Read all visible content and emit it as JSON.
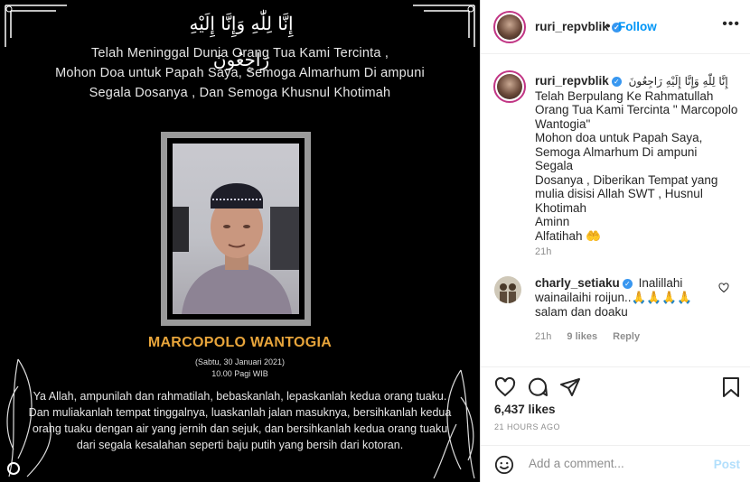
{
  "media": {
    "arabic_banner": "إِنَّا لِلّٰهِ وَإِنَّا إِلَيْهِ رَاجِعُونَ",
    "intro_lines": [
      "Telah Meninggal Dunia Orang Tua Kami Tercinta ,",
      "Mohon Doa untuk Papah Saya, Semoga Almarhum  Di ampuni",
      "Segala Dosanya , Dan Semoga Khusnul  Khotimah"
    ],
    "name": "MARCOPOLO WANTOGIA",
    "date_line": "(Sabtu, 30 Januari 2021)",
    "time_line": "10.00 Pagi WIB",
    "prayer_lines": [
      "Ya Allah, ampunilah dan rahmatilah, bebaskanlah, lepaskanlah kedua orang tuaku.",
      "Dan muliakanlah tempat tinggalnya, luaskanlah jalan masuknya, bersihkanlah kedua",
      "orang tuaku dengan air yang jernih dan sejuk, dan bersihkanlah kedua orang tuaku",
      "dari segala kesalahan seperti baju putih yang bersih dari kotoran."
    ]
  },
  "header": {
    "username": "ruri_repvblik",
    "follow_label": "Follow",
    "more_label": "•••"
  },
  "caption": {
    "username": "ruri_repvblik",
    "arabic": "إِنَّا لِلّٰهِ وَإِنَّا إِلَيْهِ رَاجِعُونَ",
    "lines": [
      "Telah Berpulang Ke Rahmatullah",
      "Orang Tua Kami Tercinta \" Marcopolo",
      "Wantogia\"",
      "Mohon doa untuk Papah Saya,",
      "Semoga Almarhum Di ampuni Segala",
      "Dosanya , Diberikan Tempat yang",
      "mulia disisi Allah SWT , Husnul",
      "Khotimah",
      "Aminn",
      "Alfatihah 🤲"
    ],
    "time": "21h"
  },
  "comment": {
    "username": "charly_setiaku",
    "text_lines": [
      "Inalillahi",
      "wainailaihi roijun..🙏🙏🙏🙏",
      "salam dan doaku"
    ],
    "time": "21h",
    "likes": "9 likes",
    "reply_label": "Reply"
  },
  "stats": {
    "likes": "6,437 likes",
    "ago": "21 HOURS AGO"
  },
  "add_comment": {
    "placeholder": "Add a comment...",
    "post_label": "Post"
  },
  "colors": {
    "accent": "#0095f6",
    "name_gold": "#e8a53b",
    "media_bg": "#000000"
  },
  "icons": [
    "heart-icon",
    "comment-icon",
    "share-icon",
    "bookmark-icon",
    "verified-icon",
    "smiley-icon",
    "more-icon"
  ]
}
